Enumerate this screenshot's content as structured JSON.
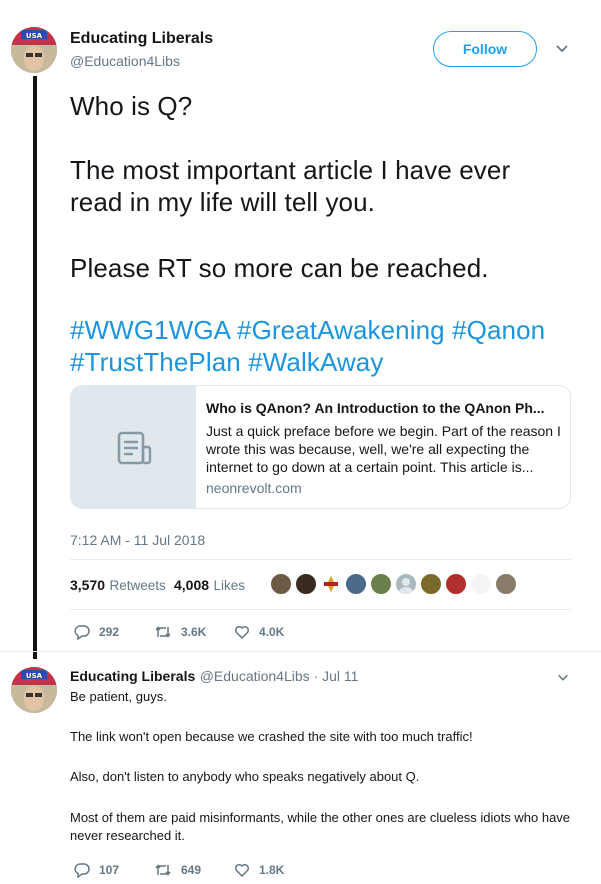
{
  "main_tweet": {
    "display_name": "Educating Liberals",
    "handle": "@Education4Libs",
    "follow_label": "Follow",
    "text_lines": {
      "l1": "Who is Q?",
      "l2": "The most important article I have ever",
      "l3": "read in my life will tell you.",
      "l4": "Please RT so more can be reached."
    },
    "hashtags": {
      "h1": "#WWG1WGA",
      "h2": "#GreatAwakening",
      "h3": "#Qanon",
      "h4": "#TrustThePlan",
      "h5": "#WalkAway"
    },
    "card": {
      "title": "Who is QAnon? An Introduction to the QAnon Ph...",
      "description": "Just a quick preface before we begin. Part of the reason I wrote this was because, well, we're all expecting the internet to go down at a certain point. This article is...",
      "domain": "neonrevolt.com",
      "icon": "document-icon"
    },
    "timestamp": "7:12 AM - 11 Jul 2018",
    "retweets_count": "3,570",
    "retweets_label": "Retweets",
    "likes_count": "4,008",
    "likes_label": "Likes",
    "actions": {
      "replies": "292",
      "retweets": "3.6K",
      "likes": "4.0K"
    }
  },
  "reply_tweet": {
    "display_name": "Educating Liberals",
    "handle_date": "@Education4Libs · Jul 11",
    "paragraphs": {
      "p1": "Be patient, guys.",
      "p2": "The link won't open because we crashed the site with too much traffic!",
      "p3": "Also, don't listen to anybody who speaks negatively about Q.",
      "p4": "Most of them are paid misinformants, while the other ones are clueless idiots who have never researched it."
    },
    "actions": {
      "replies": "107",
      "retweets": "649",
      "likes": "1.8K"
    }
  },
  "colors": {
    "accent": "#1da1f2",
    "hashtag": "#1b95e0",
    "muted": "#657786",
    "border": "#e1e8ed"
  }
}
